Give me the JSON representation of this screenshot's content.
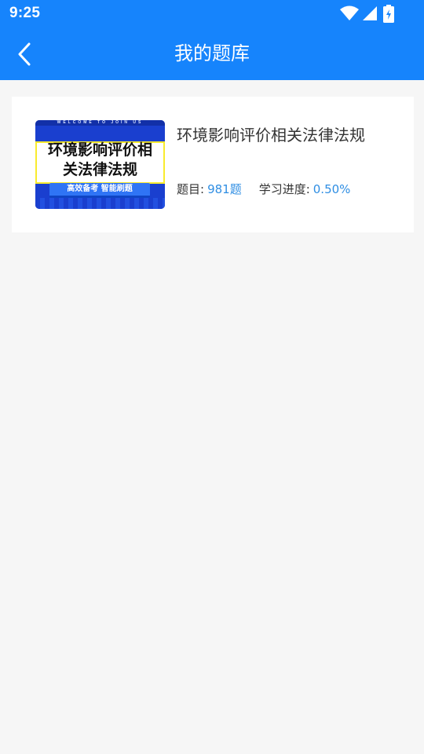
{
  "status_bar": {
    "time": "9:25",
    "icons": [
      "wifi-icon",
      "signal-icon",
      "battery-charging-icon"
    ]
  },
  "toolbar": {
    "back_icon": "chevron-left-icon",
    "title": "我的题库"
  },
  "colors": {
    "header": "#1684fc",
    "background": "#f6f6f6",
    "accent": "#2f8ee3"
  },
  "banks": [
    {
      "cover": {
        "banner": "WELCOME TO JOIN US",
        "title_line1": "环境影响评价相",
        "title_line2": "关法律法规",
        "ribbon": "高效备考 智能刷题"
      },
      "title": "环境影响评价相关法律法规",
      "question_label": "题目:",
      "question_count": "981题",
      "progress_label": "学习进度:",
      "progress_value": "0.50%"
    }
  ]
}
